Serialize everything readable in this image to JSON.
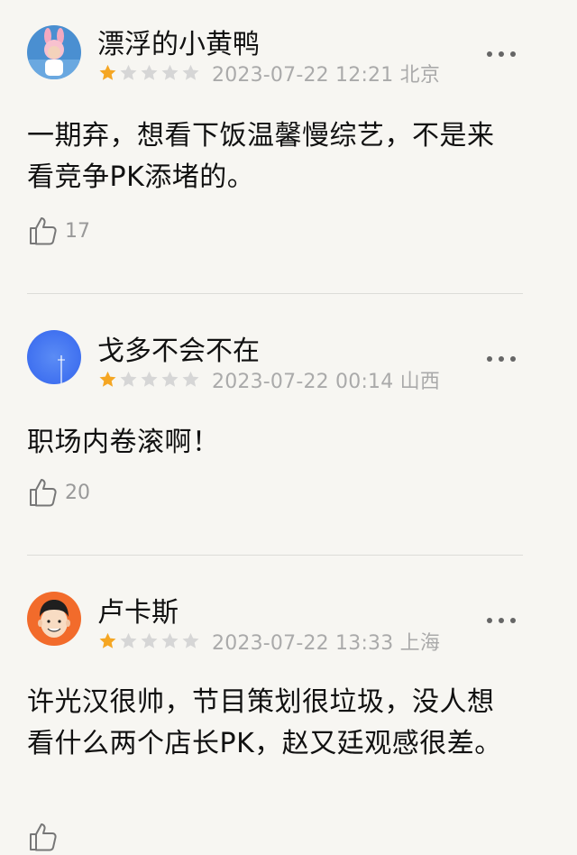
{
  "reviews": [
    {
      "username": "漂浮的小黄鸭",
      "rating": 1,
      "max_rating": 5,
      "date": "2023-07-22 12:21 北京",
      "content": "一期弃，想看下饭温馨慢综艺，不是来看竞争PK添堵的。",
      "likes": "17",
      "avatar_icon": "pink-bunny-hat-child-avatar"
    },
    {
      "username": "戈多不会不在",
      "rating": 1,
      "max_rating": 5,
      "date": "2023-07-22 00:14 山西",
      "content": "职场内卷滚啊！",
      "likes": "20",
      "avatar_icon": "blue-sky-avatar"
    },
    {
      "username": "卢卡斯",
      "rating": 1,
      "max_rating": 5,
      "date": "2023-07-22 13:33 上海",
      "content": "许光汉很帅，节目策划很垃圾，没人想看什么两个店长PK，赵又廷观感很差。",
      "likes": "",
      "avatar_icon": "cartoon-man-orange-avatar"
    }
  ],
  "colors": {
    "background": "#f7f6f2",
    "star_filled": "#f5a623",
    "star_empty": "#d6d6d6",
    "meta_text": "#aaaaaa",
    "divider": "#dcdcd8"
  }
}
